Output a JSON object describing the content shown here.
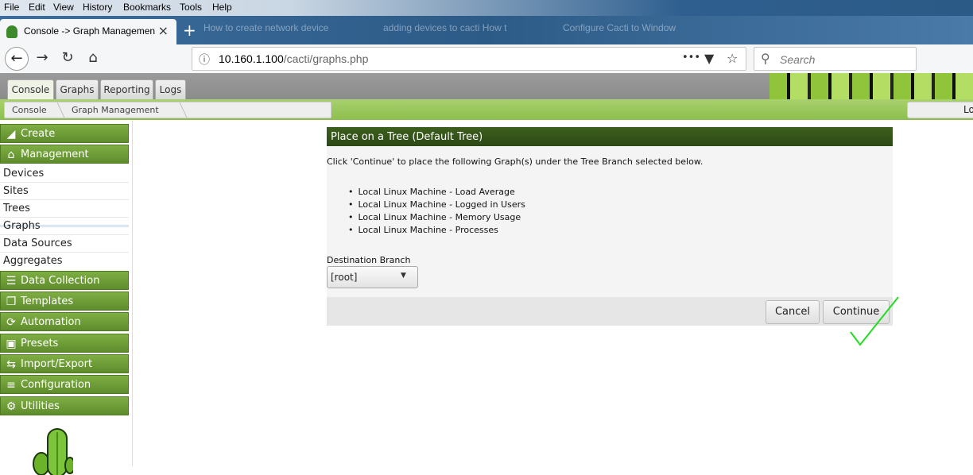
{
  "browser": {
    "menu": [
      "File",
      "Edit",
      "View",
      "History",
      "Bookmarks",
      "Tools",
      "Help"
    ],
    "active_tab_title": "Console -> Graph Managemen",
    "tab_close": "×",
    "background_tabs": [
      "How to create network device",
      "adding devices to cacti How t",
      "Configure Cacti to Window"
    ],
    "new_tab": "+",
    "url_host": "10.160.1.100",
    "url_path": "/cacti/graphs.php",
    "url_more": "•••",
    "search_placeholder": "Search"
  },
  "cacti": {
    "tabs": [
      "Console",
      "Graphs",
      "Reporting",
      "Logs"
    ],
    "breadcrumb": [
      "Console",
      "Graph Management"
    ],
    "login_text": "Lo",
    "sidebar": {
      "create": "Create",
      "management": "Management",
      "management_items": [
        "Devices",
        "Sites",
        "Trees",
        "Graphs",
        "Data Sources",
        "Aggregates"
      ],
      "sections": [
        "Data Collection",
        "Templates",
        "Automation",
        "Presets",
        "Import/Export",
        "Configuration",
        "Utilities"
      ]
    },
    "panel": {
      "title": "Place on a Tree (Default Tree)",
      "instruction": "Click 'Continue' to place the following Graph(s) under the Tree Branch selected below.",
      "graphs": [
        "Local Linux Machine - Load Average",
        "Local Linux Machine - Logged in Users",
        "Local Linux Machine - Memory Usage",
        "Local Linux Machine - Processes"
      ],
      "destination_label": "Destination Branch",
      "destination_value": "[root]",
      "cancel": "Cancel",
      "continue": "Continue"
    }
  },
  "colors": {
    "accent_green": "#5e8c2c",
    "header_dark": "#2c4815",
    "check": "#22dd22"
  }
}
